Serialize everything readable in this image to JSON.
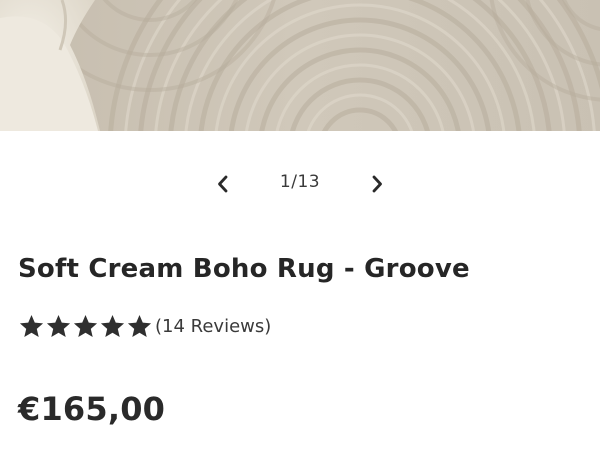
{
  "gallery": {
    "current": "1",
    "separator": "/",
    "total": "13",
    "prev_icon": "chevron-left-icon",
    "next_icon": "chevron-right-icon"
  },
  "product": {
    "title": "Soft Cream Boho Rug - Groove",
    "rating_value": 5,
    "rating_max": 5,
    "reviews_label": "(14 Reviews)",
    "price": "€165,00"
  },
  "colors": {
    "text": "#262626",
    "star": "#2f2f2f",
    "rug": "#cbc3b5",
    "sofa": "#ece7dc"
  }
}
